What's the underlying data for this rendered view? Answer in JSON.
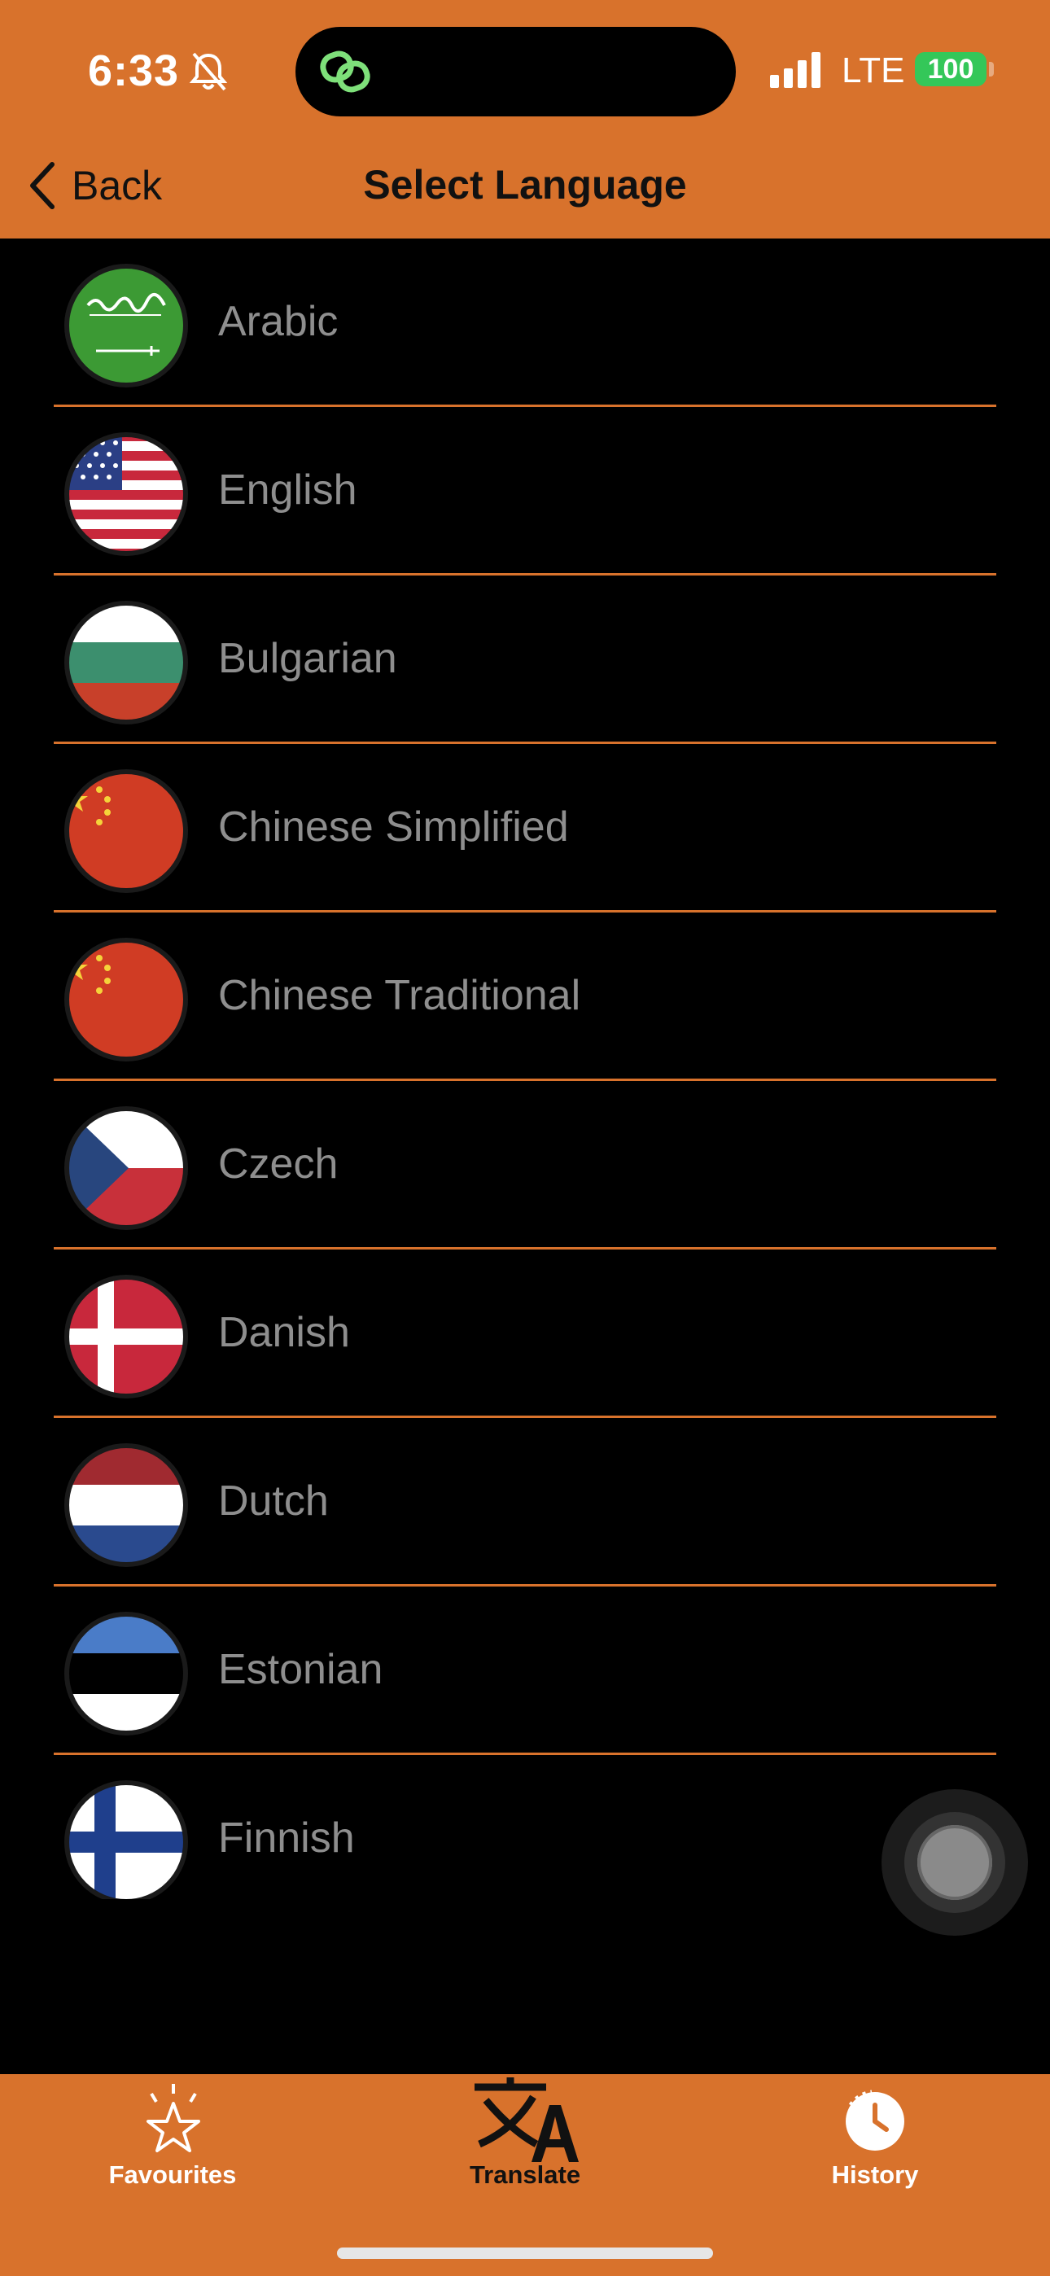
{
  "status_bar": {
    "time": "6:33",
    "network": "LTE",
    "battery": "100",
    "icons": [
      "bell-slash-icon",
      "link-icon",
      "signal-bars-icon",
      "battery-icon"
    ]
  },
  "nav": {
    "back_label": "Back",
    "title": "Select Language"
  },
  "languages": [
    {
      "label": "Arabic",
      "flag": "saudi-arabia-flag"
    },
    {
      "label": "English",
      "flag": "usa-flag"
    },
    {
      "label": "Bulgarian",
      "flag": "bulgaria-flag"
    },
    {
      "label": "Chinese Simplified",
      "flag": "china-flag"
    },
    {
      "label": "Chinese Traditional",
      "flag": "china-flag"
    },
    {
      "label": "Czech",
      "flag": "czech-flag"
    },
    {
      "label": "Danish",
      "flag": "denmark-flag"
    },
    {
      "label": "Dutch",
      "flag": "netherlands-flag"
    },
    {
      "label": "Estonian",
      "flag": "estonia-flag"
    },
    {
      "label": "Finnish",
      "flag": "finland-flag"
    }
  ],
  "tabs": [
    {
      "label": "Favourites",
      "icon": "star-icon"
    },
    {
      "label": "Translate",
      "icon": "translate-icon"
    },
    {
      "label": "History",
      "icon": "clock-icon"
    }
  ],
  "colors": {
    "accent": "#d8722c",
    "background": "#000000",
    "label": "#8e8e8e",
    "battery": "#34c759"
  }
}
